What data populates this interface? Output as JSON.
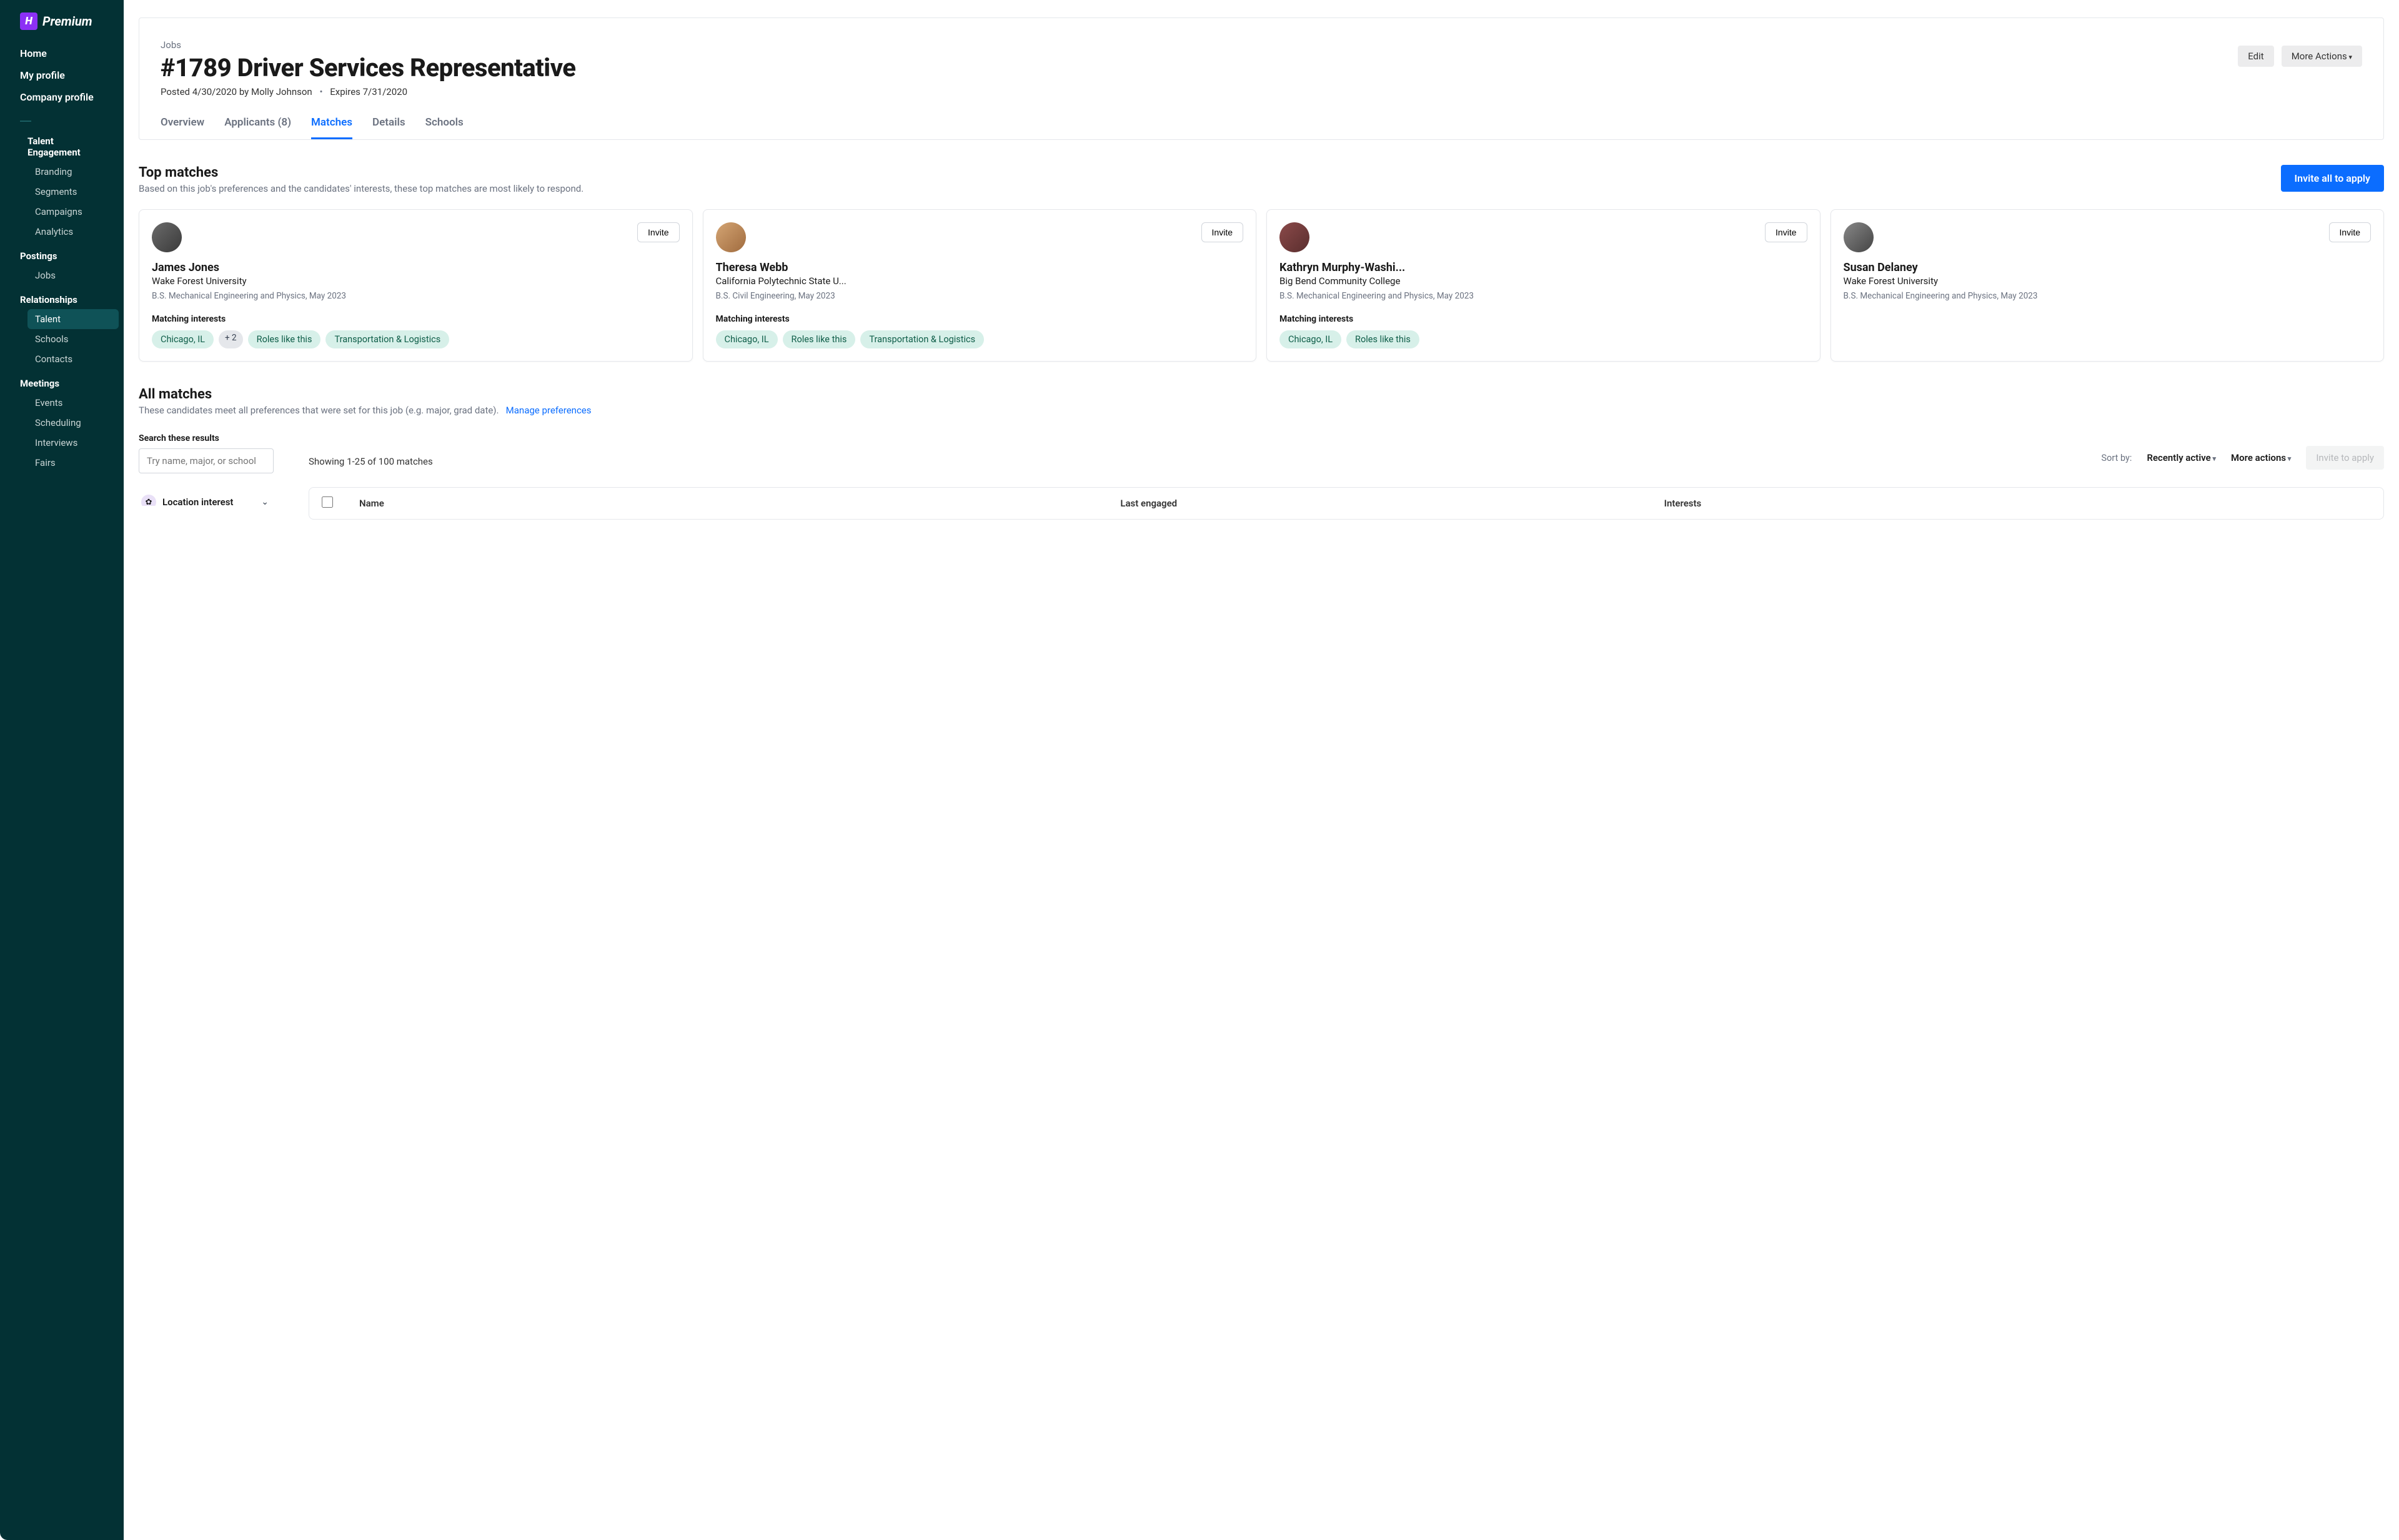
{
  "brand": {
    "logo_letter": "H",
    "logo_text": "Premium"
  },
  "sidebar": {
    "primary": [
      {
        "label": "Home"
      },
      {
        "label": "My profile"
      },
      {
        "label": "Company profile"
      }
    ],
    "section_talent_engagement": "Talent Engagement",
    "talent_engagement_items": [
      {
        "label": "Branding"
      },
      {
        "label": "Segments"
      },
      {
        "label": "Campaigns"
      },
      {
        "label": "Analytics"
      }
    ],
    "section_postings": "Postings",
    "postings_items": [
      {
        "label": "Jobs"
      }
    ],
    "section_relationships": "Relationships",
    "relationships_items": [
      {
        "label": "Talent",
        "active": true
      },
      {
        "label": "Schools"
      },
      {
        "label": "Contacts"
      }
    ],
    "section_meetings": "Meetings",
    "meetings_items": [
      {
        "label": "Events"
      },
      {
        "label": "Scheduling"
      },
      {
        "label": "Interviews"
      },
      {
        "label": "Fairs"
      }
    ]
  },
  "header": {
    "breadcrumb": "Jobs",
    "title": "#1789 Driver Services Representative",
    "posted": "Posted 4/30/2020 by Molly Johnson",
    "expires": "Expires 7/31/2020",
    "edit_label": "Edit",
    "more_actions_label": "More Actions"
  },
  "tabs": [
    {
      "label": "Overview"
    },
    {
      "label": "Applicants (8)"
    },
    {
      "label": "Matches",
      "active": true
    },
    {
      "label": "Details"
    },
    {
      "label": "Schools"
    }
  ],
  "top_matches": {
    "title": "Top matches",
    "subtitle": "Based on this job's preferences and the candidates' interests, these top matches are most likely to respond.",
    "invite_all_label": "Invite all to apply",
    "invite_label": "Invite",
    "interests_label": "Matching interests",
    "more_pill": "+ 2",
    "cards": [
      {
        "name": "James Jones",
        "school": "Wake Forest University",
        "degree": "B.S. Mechanical Engineering and Physics, May 2023",
        "pills": [
          "Chicago, IL",
          "Roles like this",
          "Transportation & Logistics"
        ],
        "has_more": true
      },
      {
        "name": "Theresa Webb",
        "school": "California Polytechnic State U...",
        "degree": "B.S. Civil Engineering, May 2023",
        "pills": [
          "Chicago, IL",
          "Roles like this",
          "Transportation & Logistics"
        ],
        "has_more": false
      },
      {
        "name": "Kathryn Murphy-Washi...",
        "school": "Big Bend Community College",
        "degree": "B.S. Mechanical Engineering and Physics, May 2023",
        "pills": [
          "Chicago, IL",
          "Roles like this"
        ],
        "has_more": false
      },
      {
        "name": "Susan Delaney",
        "school": "Wake Forest University",
        "degree": "B.S. Mechanical Engineering and Physics, May 2023",
        "pills": [],
        "has_more": false
      }
    ]
  },
  "all_matches": {
    "title": "All matches",
    "subtitle": "These candidates meet all preferences that were set for this job (e.g. major, grad date).",
    "manage_link": "Manage preferences",
    "search_label": "Search these results",
    "search_placeholder": "Try name, major, or school",
    "showing": "Showing 1-25 of 100 matches",
    "sort_by_label": "Sort by:",
    "sort_value": "Recently active",
    "more_actions": "More actions",
    "invite_to_apply": "Invite to apply",
    "filter_location": "Location interest",
    "table_headers": {
      "name": "Name",
      "last_engaged": "Last engaged",
      "interests": "Interests"
    }
  }
}
